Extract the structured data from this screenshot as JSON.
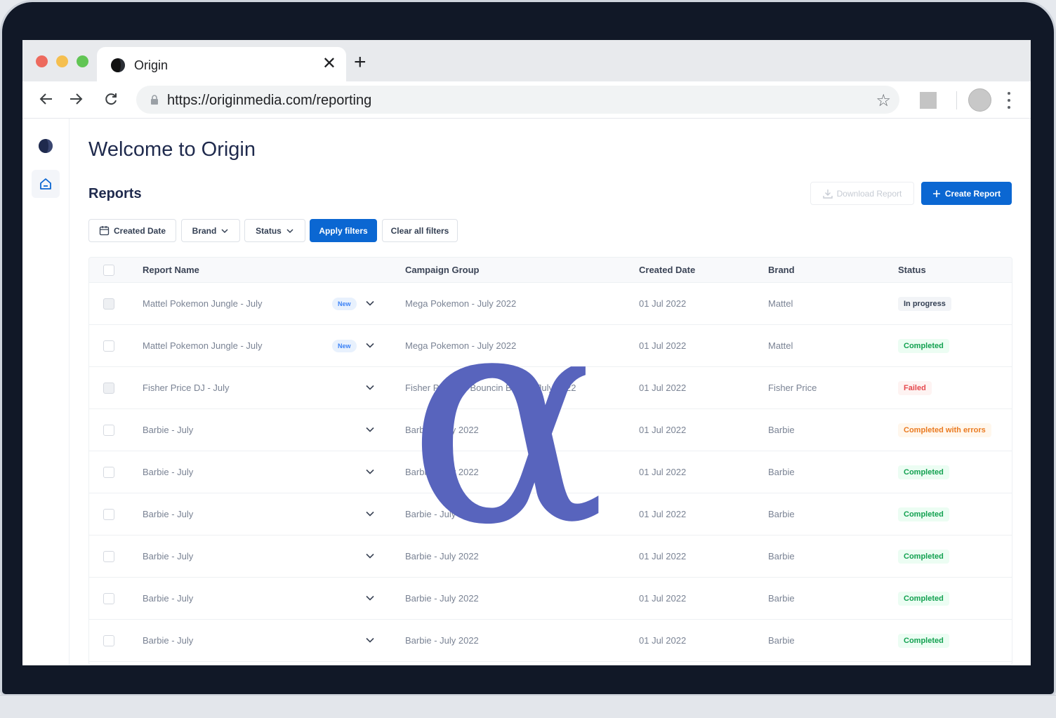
{
  "browser": {
    "tab_title": "Origin",
    "url": "https://originmedia.com/reporting"
  },
  "app": {
    "page_title": "Welcome to Origin",
    "section_title": "Reports",
    "download_label": "Download Report",
    "create_label": "Create Report",
    "filters": {
      "created_date": "Created Date",
      "brand": "Brand",
      "status": "Status",
      "apply": "Apply filters",
      "clear": "Clear all filters"
    },
    "columns": [
      "Report Name",
      "Campaign Group",
      "Created Date",
      "Brand",
      "Status"
    ],
    "new_label": "New",
    "rows": [
      {
        "name": "Mattel Pokemon Jungle - July",
        "is_new": true,
        "campaign": "Mega Pokemon - July 2022",
        "date": "01 Jul 2022",
        "brand": "Mattel",
        "status": "In progress",
        "status_kind": "progress",
        "checkbox_grey": true
      },
      {
        "name": "Mattel Pokemon Jungle - July",
        "is_new": true,
        "campaign": "Mega Pokemon - July 2022",
        "date": "01 Jul 2022",
        "brand": "Mattel",
        "status": "Completed",
        "status_kind": "completed",
        "checkbox_grey": false
      },
      {
        "name": "Fisher Price DJ - July",
        "is_new": false,
        "campaign": "Fisher Price DJ Bouncin Beats - July 2022",
        "date": "01 Jul 2022",
        "brand": "Fisher Price",
        "status": "Failed",
        "status_kind": "failed",
        "checkbox_grey": true
      },
      {
        "name": "Barbie - July",
        "is_new": false,
        "campaign": "Barbie - July 2022",
        "date": "01 Jul 2022",
        "brand": "Barbie",
        "status": "Completed with errors",
        "status_kind": "errors",
        "checkbox_grey": false
      },
      {
        "name": "Barbie - July",
        "is_new": false,
        "campaign": "Barbie - July 2022",
        "date": "01 Jul 2022",
        "brand": "Barbie",
        "status": "Completed",
        "status_kind": "completed",
        "checkbox_grey": false
      },
      {
        "name": "Barbie - July",
        "is_new": false,
        "campaign": "Barbie - July 2022",
        "date": "01 Jul 2022",
        "brand": "Barbie",
        "status": "Completed",
        "status_kind": "completed",
        "checkbox_grey": false
      },
      {
        "name": "Barbie - July",
        "is_new": false,
        "campaign": "Barbie - July 2022",
        "date": "01 Jul 2022",
        "brand": "Barbie",
        "status": "Completed",
        "status_kind": "completed",
        "checkbox_grey": false
      },
      {
        "name": "Barbie - July",
        "is_new": false,
        "campaign": "Barbie - July 2022",
        "date": "01 Jul 2022",
        "brand": "Barbie",
        "status": "Completed",
        "status_kind": "completed",
        "checkbox_grey": false
      },
      {
        "name": "Barbie - July",
        "is_new": false,
        "campaign": "Barbie - July 2022",
        "date": "01 Jul 2022",
        "brand": "Barbie",
        "status": "Completed",
        "status_kind": "completed",
        "checkbox_grey": false
      }
    ]
  },
  "overlay": {
    "glyph": "α",
    "color": "#5864bd"
  },
  "colors": {
    "primary": "#0b67d2",
    "heading": "#1f2a4d",
    "completed_bg": "#ecfdf3",
    "completed_fg": "#12a150",
    "failed_bg": "#fef3f2",
    "failed_fg": "#e5484d",
    "errors_bg": "#fff7ed",
    "errors_fg": "#ea7a20",
    "progress_bg": "#f2f4f7",
    "progress_fg": "#344054"
  },
  "icons": [
    "origin-logo-icon",
    "close-icon",
    "plus-icon",
    "back-arrow-icon",
    "forward-arrow-icon",
    "reload-icon",
    "lock-icon",
    "star-icon",
    "extension-icon",
    "avatar",
    "kebab-menu-icon",
    "home-icon",
    "calendar-icon",
    "chevron-down-icon",
    "download-icon"
  ]
}
